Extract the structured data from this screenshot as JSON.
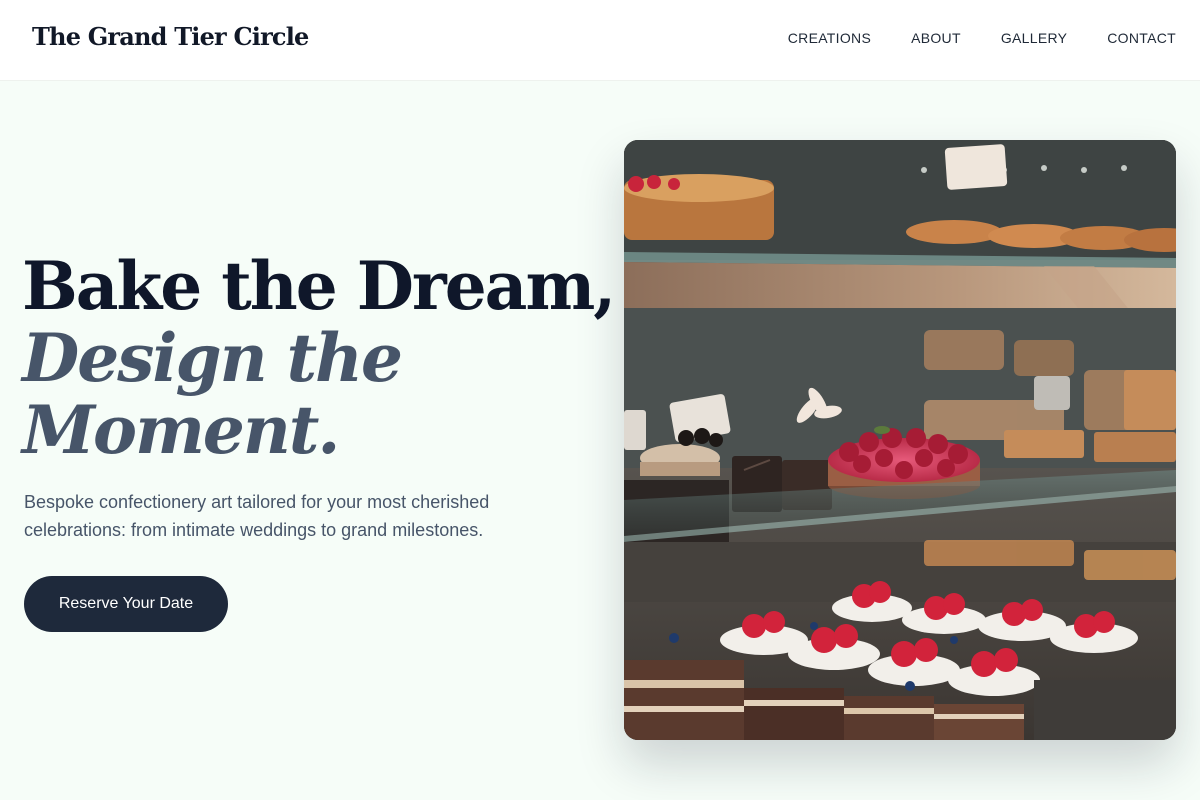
{
  "header": {
    "brand": "The Grand Tier Circle",
    "nav": [
      "CREATIONS",
      "ABOUT",
      "GALLERY",
      "CONTACT"
    ]
  },
  "hero": {
    "title_line1": "Bake the Dream,",
    "title_line2": "Design the",
    "title_line3": "Moment.",
    "subtitle": "Bespoke confectionery art tailored for your most cherished celebrations: from intimate weddings to grand milestones.",
    "cta_label": "Reserve Your Date",
    "image_alt": "Pastry display case with cakes and tarts"
  },
  "colors": {
    "page_background": "#f6fdf8",
    "header_background": "#ffffff",
    "title_dark": "#0f172a",
    "title_italic": "#475569",
    "button_background": "#1e293b",
    "button_text": "#ffffff"
  }
}
